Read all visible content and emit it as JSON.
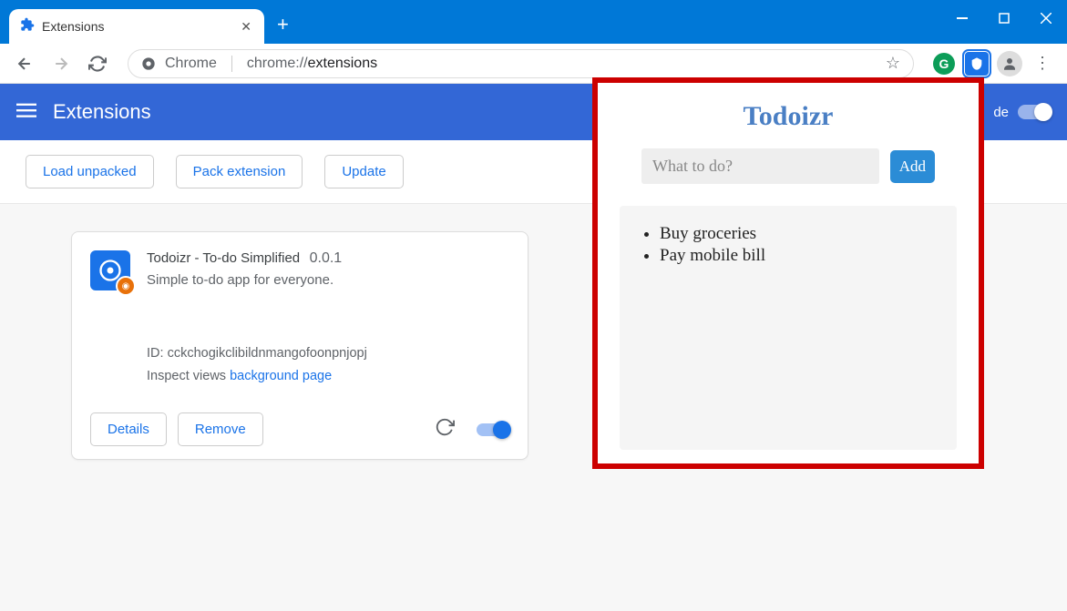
{
  "window": {
    "tab_title": "Extensions"
  },
  "omnibox": {
    "scheme_label": "Chrome",
    "url_prefix": "chrome://",
    "url_path": "extensions"
  },
  "header": {
    "title": "Extensions",
    "dev_mode_label": "de"
  },
  "actions": {
    "load_unpacked": "Load unpacked",
    "pack_extension": "Pack extension",
    "update": "Update"
  },
  "extension_card": {
    "name": "Todoizr - To-do Simplified",
    "version": "0.0.1",
    "description": "Simple to-do app for everyone.",
    "id_label": "ID: ",
    "id_value": "cckchogikclibildnmangofoonpnjopj",
    "inspect_label": "Inspect views ",
    "inspect_link": "background page",
    "details_btn": "Details",
    "remove_btn": "Remove"
  },
  "popup": {
    "title": "Todoizr",
    "input_placeholder": "What to do?",
    "add_btn": "Add",
    "items": [
      "Buy groceries",
      "Pay mobile bill"
    ]
  }
}
